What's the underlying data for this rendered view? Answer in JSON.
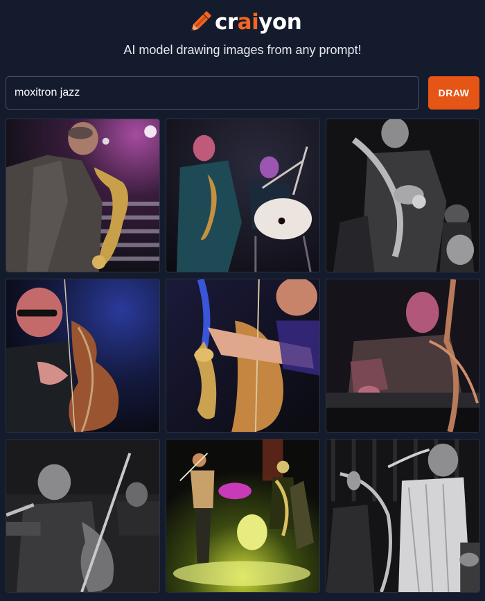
{
  "brand": {
    "name_prefix": "cr",
    "name_accent": "ai",
    "name_suffix": "yon",
    "accent_color": "#f26522",
    "icon": "pencil-icon"
  },
  "tagline": "AI model drawing images from any prompt!",
  "search": {
    "value": "moxitron jazz",
    "placeholder": ""
  },
  "draw_button": {
    "label": "DRAW",
    "color": "#e55516"
  },
  "results": {
    "prompt": "moxitron jazz",
    "images": [
      {
        "subject": "saxophone player on stage"
      },
      {
        "subject": "saxophone player with drum"
      },
      {
        "subject": "saxophone player in monochrome"
      },
      {
        "subject": "upright bass player with glasses"
      },
      {
        "subject": "saxophone and upright bass"
      },
      {
        "subject": "saxophone player at keyboard"
      },
      {
        "subject": "upright bass player in monochrome"
      },
      {
        "subject": "jazz band on stage with yellow lights"
      },
      {
        "subject": "horn section in monochrome"
      }
    ]
  }
}
